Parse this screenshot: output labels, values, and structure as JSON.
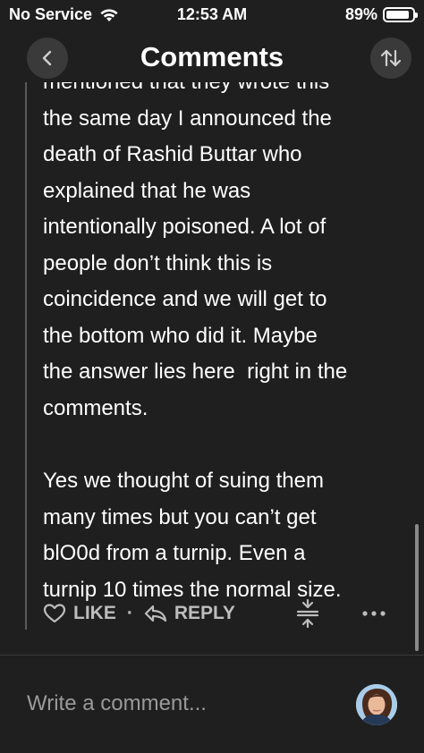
{
  "status": {
    "carrier": "No Service",
    "time": "12:53 AM",
    "battery": "89%",
    "battery_level": 0.89
  },
  "header": {
    "title": "Comments"
  },
  "comment": {
    "partial_line": "mentioned that they wrote this",
    "lines": [
      "the same day I announced the",
      "death of Rashid Buttar who",
      "explained that he was",
      "intentionally poisoned. A lot of",
      "people don’t think this is",
      "coincidence and we will get to",
      "the bottom who did it. Maybe",
      "the answer lies here  right in the",
      "comments."
    ],
    "lines2": [
      "Yes we thought of suing them",
      "many times but you can’t get",
      "blO0d from a turnip. Even a",
      "turnip 10 times the normal size."
    ]
  },
  "actions": {
    "like": "LIKE",
    "separator": "·",
    "reply": "REPLY"
  },
  "footer": {
    "placeholder": "Write a comment..."
  },
  "colors": {
    "background": "#1f1f1f",
    "text": "#ffffff",
    "muted": "#bdbdbd",
    "button": "#3a3a3a"
  }
}
